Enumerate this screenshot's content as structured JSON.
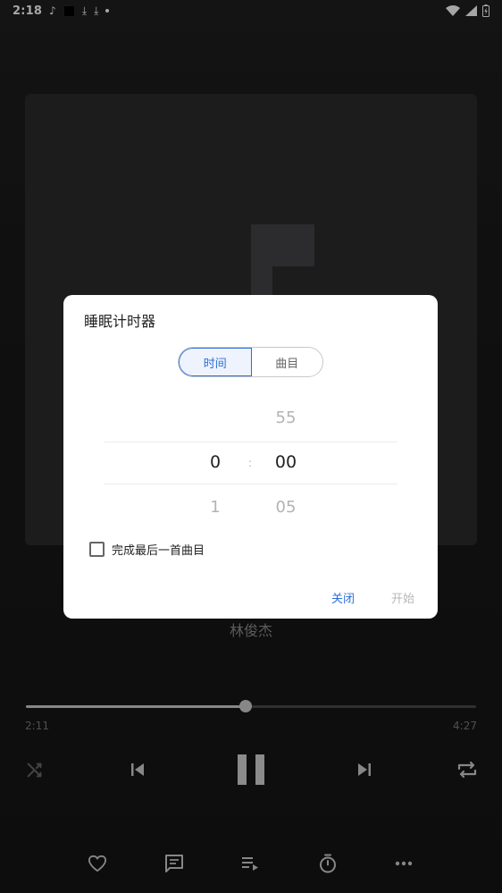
{
  "status_bar": {
    "time": "2:18",
    "icons_left": [
      "music-note-icon",
      "black-square-icon",
      "download-icon",
      "download-icon",
      "dot-icon"
    ],
    "icons_right": [
      "wifi-icon",
      "signal-icon",
      "battery-icon"
    ]
  },
  "player": {
    "artist": "林俊杰",
    "elapsed": "2:11",
    "total": "4:27",
    "progress": 0.489
  },
  "dialog": {
    "title": "睡眠计时器",
    "tabs": [
      {
        "label": "时间",
        "active": true
      },
      {
        "label": "曲目",
        "active": false
      }
    ],
    "picker": {
      "hours_prev": "",
      "hours_selected": "0",
      "hours_next": "1",
      "minutes_prev": "55",
      "minutes_selected": "00",
      "minutes_next": "05",
      "separator": ":"
    },
    "checkbox_label": "完成最后一首曲目",
    "checkbox_checked": false,
    "close_label": "关闭",
    "start_label": "开始"
  },
  "colors": {
    "accent": "#2f6fd6",
    "background": "#181818",
    "dialog_bg": "#ffffff"
  }
}
